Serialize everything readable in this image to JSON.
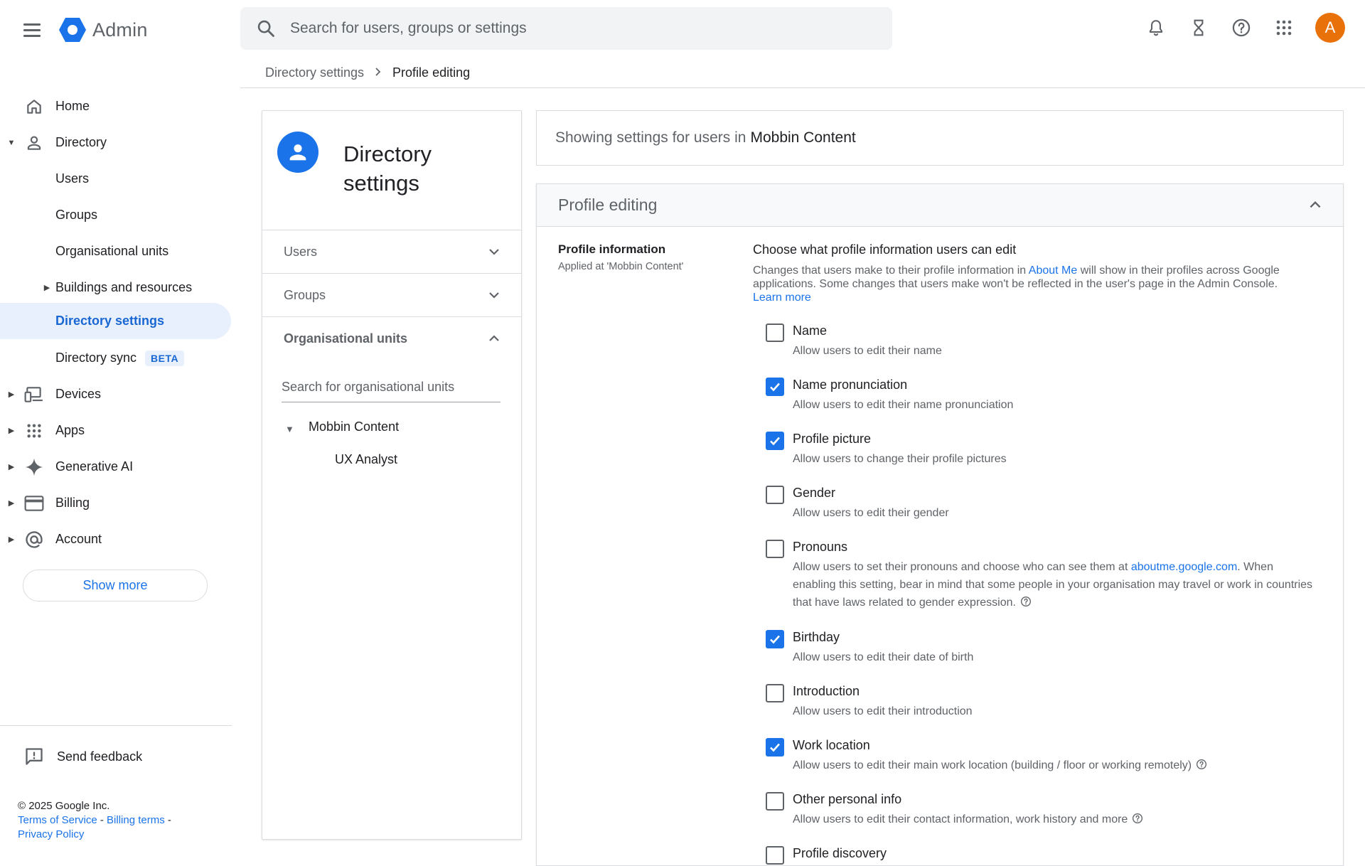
{
  "app": {
    "title": "Admin"
  },
  "search": {
    "placeholder": "Search for users, groups or settings"
  },
  "user": {
    "avatar_initial": "A"
  },
  "breadcrumb": {
    "parent": "Directory settings",
    "current": "Profile editing"
  },
  "sidebar": {
    "items": [
      {
        "label": "Home"
      },
      {
        "label": "Directory"
      },
      {
        "label": "Users"
      },
      {
        "label": "Groups"
      },
      {
        "label": "Organisational units"
      },
      {
        "label": "Buildings and resources"
      },
      {
        "label": "Directory settings"
      },
      {
        "label": "Directory sync",
        "badge": "BETA"
      },
      {
        "label": "Devices"
      },
      {
        "label": "Apps"
      },
      {
        "label": "Generative AI"
      },
      {
        "label": "Billing"
      },
      {
        "label": "Account"
      }
    ],
    "show_more": "Show more",
    "feedback": "Send feedback",
    "footer": {
      "copyright": "© 2025 Google Inc.",
      "terms": "Terms of Service",
      "billing_terms": "Billing terms",
      "privacy": "Privacy Policy"
    }
  },
  "left_card": {
    "title": "Directory settings",
    "sections": [
      "Users",
      "Groups",
      "Organisational units"
    ],
    "ou_search_placeholder": "Search for organisational units",
    "ou_tree": [
      "Mobbin Content",
      "UX Analyst"
    ]
  },
  "showing": {
    "prefix": "Showing settings for users in",
    "org": "Mobbin Content"
  },
  "panel": {
    "title": "Profile editing",
    "section_title": "Profile information",
    "section_sub": "Applied at 'Mobbin Content'",
    "choose": "Choose what profile information users can edit",
    "desc_part1": "Changes that users make to their profile information in",
    "desc_link": "About Me",
    "desc_part2": "will show in their profiles across Google applications. Some changes that users make won't be reflected in the user's page in the Admin Console.",
    "learn_more": "Learn more",
    "options": [
      {
        "label": "Name",
        "desc": "Allow users to edit their name",
        "checked": false
      },
      {
        "label": "Name pronunciation",
        "desc": "Allow users to edit their name pronunciation",
        "checked": true
      },
      {
        "label": "Profile picture",
        "desc": "Allow users to change their profile pictures",
        "checked": true
      },
      {
        "label": "Gender",
        "desc": "Allow users to edit their gender",
        "checked": false
      },
      {
        "label": "Pronouns",
        "desc_part1": "Allow users to set their pronouns and choose who can see them at",
        "desc_link": "aboutme.google.com",
        "desc_part2": ". When enabling this setting, bear in mind that some people in your organisation may travel or work in countries that have laws related to gender expression.",
        "checked": false
      },
      {
        "label": "Birthday",
        "desc": "Allow users to edit their date of birth",
        "checked": true
      },
      {
        "label": "Introduction",
        "desc": "Allow users to edit their introduction",
        "checked": false
      },
      {
        "label": "Work location",
        "desc": "Allow users to edit their main work location (building / floor or working remotely)",
        "checked": true
      },
      {
        "label": "Other personal info",
        "desc": "Allow users to edit their contact information, work history and more",
        "checked": false
      },
      {
        "label": "Profile discovery",
        "checked": false
      }
    ]
  },
  "colors": {
    "accent": "#1a73e8",
    "avatar": "#e8710a",
    "active_bg": "#e8f0fe"
  }
}
